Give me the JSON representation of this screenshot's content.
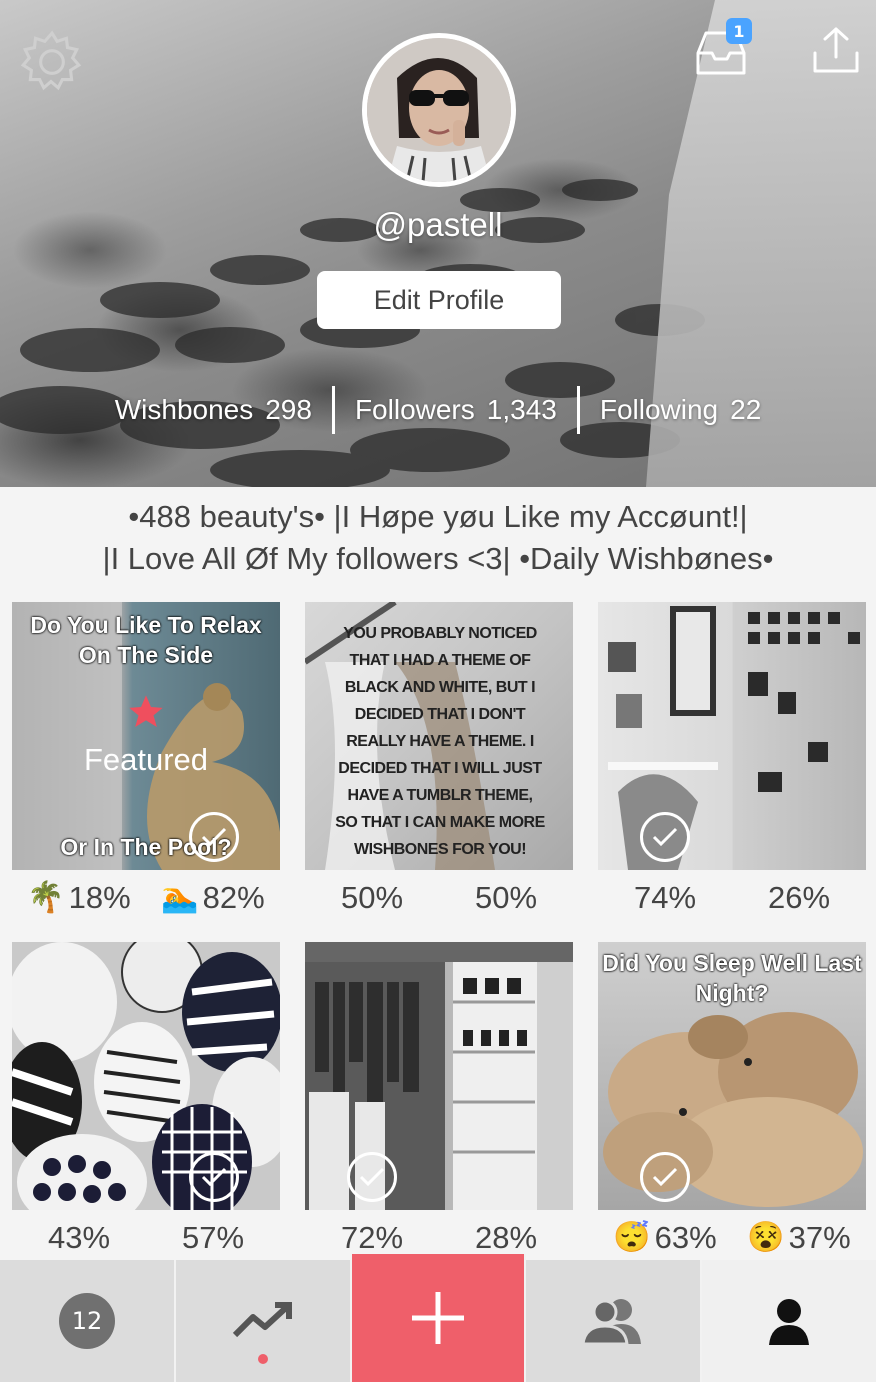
{
  "header": {
    "username": "@pastell",
    "edit_profile_label": "Edit Profile",
    "inbox_badge": "1",
    "stats": [
      {
        "label": "Wishbones",
        "value": "298"
      },
      {
        "label": "Followers",
        "value": "1,343"
      },
      {
        "label": "Following",
        "value": "22"
      }
    ]
  },
  "bio": {
    "line1": "•488 beauty's• |I Høpe yøu Like my Accøunt!|",
    "line2": "|I Love All Øf My followers <3| •Daily Wishbønes•"
  },
  "posts": [
    {
      "caption_top": "Do You Like To Relax On The Side",
      "caption_bottom": "Or In The Pool?",
      "featured_label": "Featured",
      "left_emoji": "🌴",
      "left_pct": "18%",
      "right_emoji": "🏊",
      "right_pct": "82%",
      "voted": true
    },
    {
      "caption_top": "YOU PROBABLY NOTICED THAT I HAD A THEME OF BLACK AND WHITE, BUT I DECIDED THAT I DON'T REALLY HAVE A THEME. I DECIDED THAT I WILL JUST HAVE A TUMBLR THEME, SO THAT I CAN MAKE MORE WISHBONES FOR YOU!",
      "left_pct": "50%",
      "right_pct": "50%",
      "voted": false
    },
    {
      "left_pct": "74%",
      "right_pct": "26%",
      "voted": true
    },
    {
      "left_pct": "43%",
      "right_pct": "57%",
      "voted": true
    },
    {
      "left_pct": "72%",
      "right_pct": "28%",
      "voted": true
    },
    {
      "caption_top": "Did You Sleep Well Last Night?",
      "left_emoji": "😴",
      "left_pct": "63%",
      "right_emoji": "😵",
      "right_pct": "37%",
      "voted": true
    }
  ],
  "nav": {
    "count": "12",
    "accent": "#ef5f6a"
  }
}
